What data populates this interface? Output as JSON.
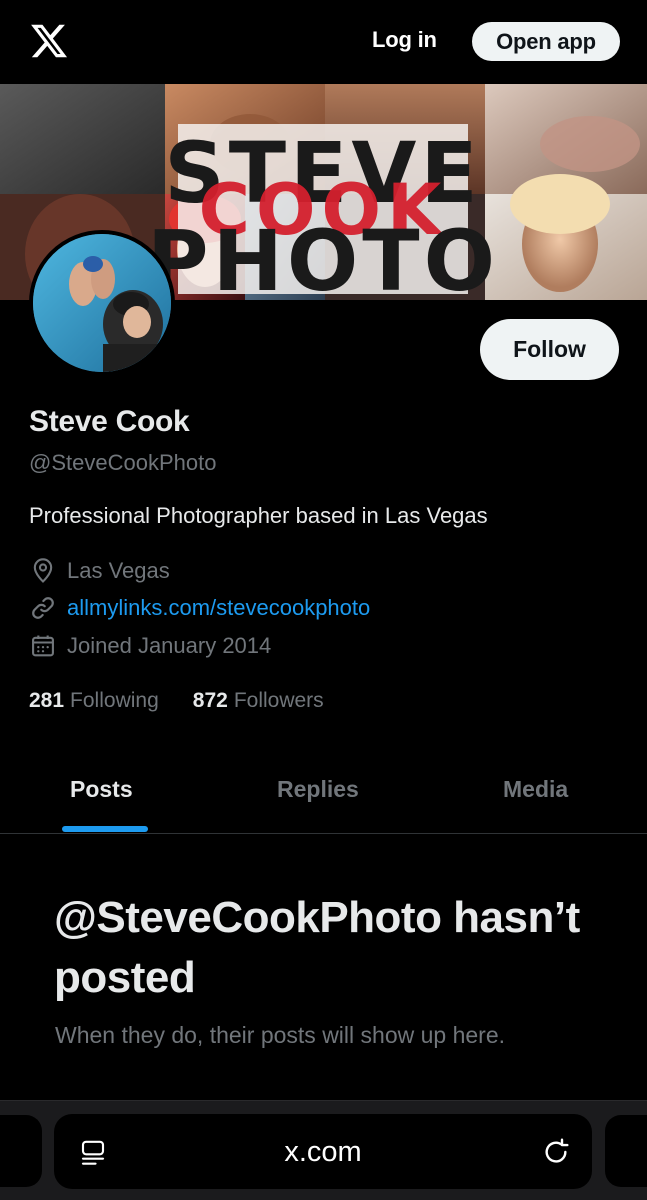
{
  "header": {
    "logo_icon": "x-logo-icon",
    "login_label": "Log in",
    "open_app_label": "Open app"
  },
  "banner": {
    "line1": "STEVE",
    "line1_overlay": "COOK",
    "line2": "PHOTO"
  },
  "profile": {
    "follow_label": "Follow",
    "name": "Steve Cook",
    "handle": "@SteveCookPhoto",
    "bio": "Professional Photographer based in Las Vegas",
    "location": "Las Vegas",
    "link": "allmylinks.com/stevecookphoto",
    "joined": "Joined January 2014",
    "following_count": "281",
    "following_label": "Following",
    "followers_count": "872",
    "followers_label": "Followers"
  },
  "tabs": [
    {
      "label": "Posts",
      "active": true
    },
    {
      "label": "Replies",
      "active": false
    },
    {
      "label": "Media",
      "active": false
    }
  ],
  "empty_state": {
    "title": "@SteveCookPhoto hasn’t posted",
    "subtitle": "When they do, their posts will show up here."
  },
  "browser": {
    "url": "x.com",
    "reader_icon": "reader-mode-icon",
    "reload_icon": "reload-icon"
  },
  "colors": {
    "background": "#000000",
    "accent": "#1d9bf0",
    "text_primary": "#e7e9ea",
    "text_secondary": "#71767b",
    "button_light": "#eff3f4",
    "banner_red": "#d4202e"
  }
}
